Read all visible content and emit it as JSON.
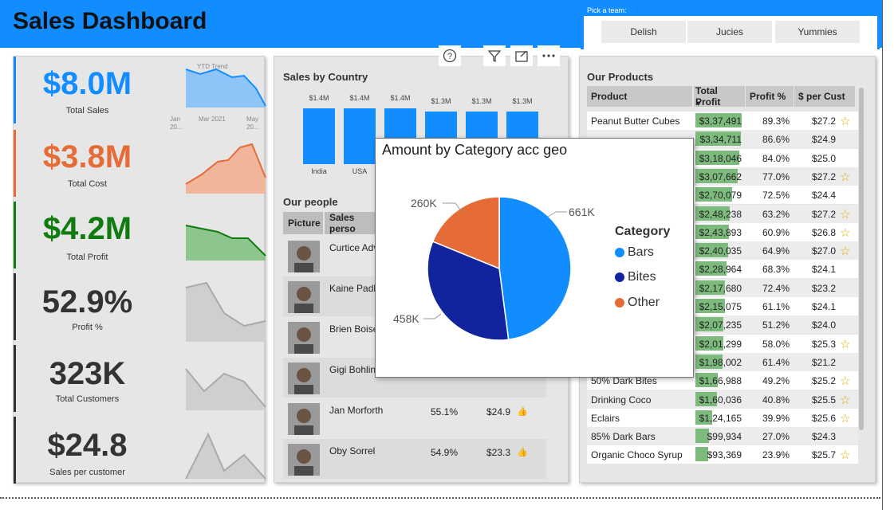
{
  "header": {
    "title": "Sales Dashboard"
  },
  "slicer": {
    "label": "Pick a team:",
    "teams": [
      "Delish",
      "Jucies",
      "Yummies"
    ]
  },
  "colors": {
    "accent": "#118DFF",
    "cost": "#E66C37",
    "profit": "#107C10",
    "bars": "#118DFF",
    "bites": "#12239E",
    "other": "#E66C37"
  },
  "kpis": [
    {
      "value": "$8.0M",
      "caption": "Total Sales",
      "color": "#118DFF"
    },
    {
      "value": "$3.8M",
      "caption": "Total Cost",
      "color": "#E66C37"
    },
    {
      "value": "$4.2M",
      "caption": "Total Profit",
      "color": "#107C10"
    },
    {
      "value": "52.9%",
      "caption": "Profit %",
      "color": "#333333"
    },
    {
      "value": "323K",
      "caption": "Total Customers",
      "color": "#333333"
    },
    {
      "value": "$24.8",
      "caption": "Sales per customer",
      "color": "#333333"
    }
  ],
  "trend": {
    "title": "YTD Trend",
    "x1": "Jan",
    "x1b": "20...",
    "x2": "Mar 2021",
    "x3": "May",
    "x3b": "20..."
  },
  "visual_icons": [
    "help-icon",
    "filter-icon",
    "focus-mode-icon",
    "more-options-icon"
  ],
  "country_chart": {
    "title": "Sales by Country",
    "bars": [
      {
        "label": "$1.4M",
        "category": "India"
      },
      {
        "label": "$1.4M",
        "category": "USA"
      },
      {
        "label": "$1.4M",
        "category": ""
      },
      {
        "label": "$1.3M",
        "category": ""
      },
      {
        "label": "$1.3M",
        "category": ""
      },
      {
        "label": "$1.3M",
        "category": ""
      }
    ]
  },
  "people": {
    "title": "Our people",
    "headers": [
      "Picture",
      "Sales perso"
    ],
    "rows": [
      {
        "name": "Curtice Adv",
        "profit_pct": "",
        "per_cust": ""
      },
      {
        "name": "Kaine Padly",
        "profit_pct": "",
        "per_cust": ""
      },
      {
        "name": "Brien Boise",
        "profit_pct": "",
        "per_cust": ""
      },
      {
        "name": "Gigi Bohling",
        "profit_pct": "",
        "per_cust": ""
      },
      {
        "name": "Jan Morforth",
        "profit_pct": "55.1%",
        "per_cust": "$24.9"
      },
      {
        "name": "Oby Sorrel",
        "profit_pct": "54.9%",
        "per_cust": "$23.3"
      }
    ]
  },
  "popup": {
    "title": "Amount by Category acc geo",
    "legend_title": "Category",
    "slices": [
      {
        "name": "Bars",
        "label": "661K",
        "value": 661
      },
      {
        "name": "Bites",
        "label": "458K",
        "value": 458
      },
      {
        "name": "Other",
        "label": "260K",
        "value": 260
      }
    ]
  },
  "chart_data": {
    "type": "pie",
    "title": "Amount by Category acc geo",
    "categories": [
      "Bars",
      "Bites",
      "Other"
    ],
    "values": [
      661000,
      458000,
      260000
    ]
  },
  "products": {
    "title": "Our Products",
    "headers": [
      "Product",
      "Total Profit",
      "Profit %",
      "$ per Cust"
    ],
    "rows": [
      {
        "product": "Peanut Butter Cubes",
        "profit": "$3,37,491",
        "pct": "89.3%",
        "cust": "$27.2",
        "star": true,
        "frac": 1.0
      },
      {
        "product": "",
        "profit": "$3,34,711",
        "pct": "86.6%",
        "cust": "$24.9",
        "star": false,
        "frac": 0.99
      },
      {
        "product": "",
        "profit": "$3,18,046",
        "pct": "84.0%",
        "cust": "$25.0",
        "star": false,
        "frac": 0.94
      },
      {
        "product": "",
        "profit": "$3,07,662",
        "pct": "77.0%",
        "cust": "$27.2",
        "star": true,
        "frac": 0.91
      },
      {
        "product": "",
        "profit": "$2,70,079",
        "pct": "72.5%",
        "cust": "$24.4",
        "star": false,
        "frac": 0.8
      },
      {
        "product": "",
        "profit": "$2,48,238",
        "pct": "63.2%",
        "cust": "$27.2",
        "star": true,
        "frac": 0.74
      },
      {
        "product": "",
        "profit": "$2,43,893",
        "pct": "60.9%",
        "cust": "$26.8",
        "star": true,
        "frac": 0.72
      },
      {
        "product": "",
        "profit": "$2,40,035",
        "pct": "64.9%",
        "cust": "$27.0",
        "star": true,
        "frac": 0.71
      },
      {
        "product": "",
        "profit": "$2,28,964",
        "pct": "68.3%",
        "cust": "$24.1",
        "star": false,
        "frac": 0.68
      },
      {
        "product": "",
        "profit": "$2,17,680",
        "pct": "72.4%",
        "cust": "$23.2",
        "star": false,
        "frac": 0.64
      },
      {
        "product": "",
        "profit": "$2,15,075",
        "pct": "61.1%",
        "cust": "$24.1",
        "star": false,
        "frac": 0.64
      },
      {
        "product": "",
        "profit": "$2,07,235",
        "pct": "51.2%",
        "cust": "$24.0",
        "star": false,
        "frac": 0.61
      },
      {
        "product": "",
        "profit": "$2,01,299",
        "pct": "58.0%",
        "cust": "$25.3",
        "star": true,
        "frac": 0.6
      },
      {
        "product": "",
        "profit": "$1,98,002",
        "pct": "61.4%",
        "cust": "$21.2",
        "star": false,
        "frac": 0.59
      },
      {
        "product": "50% Dark Bites",
        "profit": "$1,66,988",
        "pct": "49.2%",
        "cust": "$25.2",
        "star": true,
        "frac": 0.49
      },
      {
        "product": "Drinking Coco",
        "profit": "$1,60,036",
        "pct": "40.8%",
        "cust": "$25.5",
        "star": true,
        "frac": 0.47
      },
      {
        "product": "Eclairs",
        "profit": "$1,24,165",
        "pct": "39.9%",
        "cust": "$25.6",
        "star": true,
        "frac": 0.37
      },
      {
        "product": "85% Dark Bars",
        "profit": "$99,934",
        "pct": "27.0%",
        "cust": "$24.3",
        "star": false,
        "frac": 0.3
      },
      {
        "product": "Organic Choco Syrup",
        "profit": "$93,369",
        "pct": "23.9%",
        "cust": "$25.7",
        "star": true,
        "frac": 0.28
      }
    ]
  }
}
